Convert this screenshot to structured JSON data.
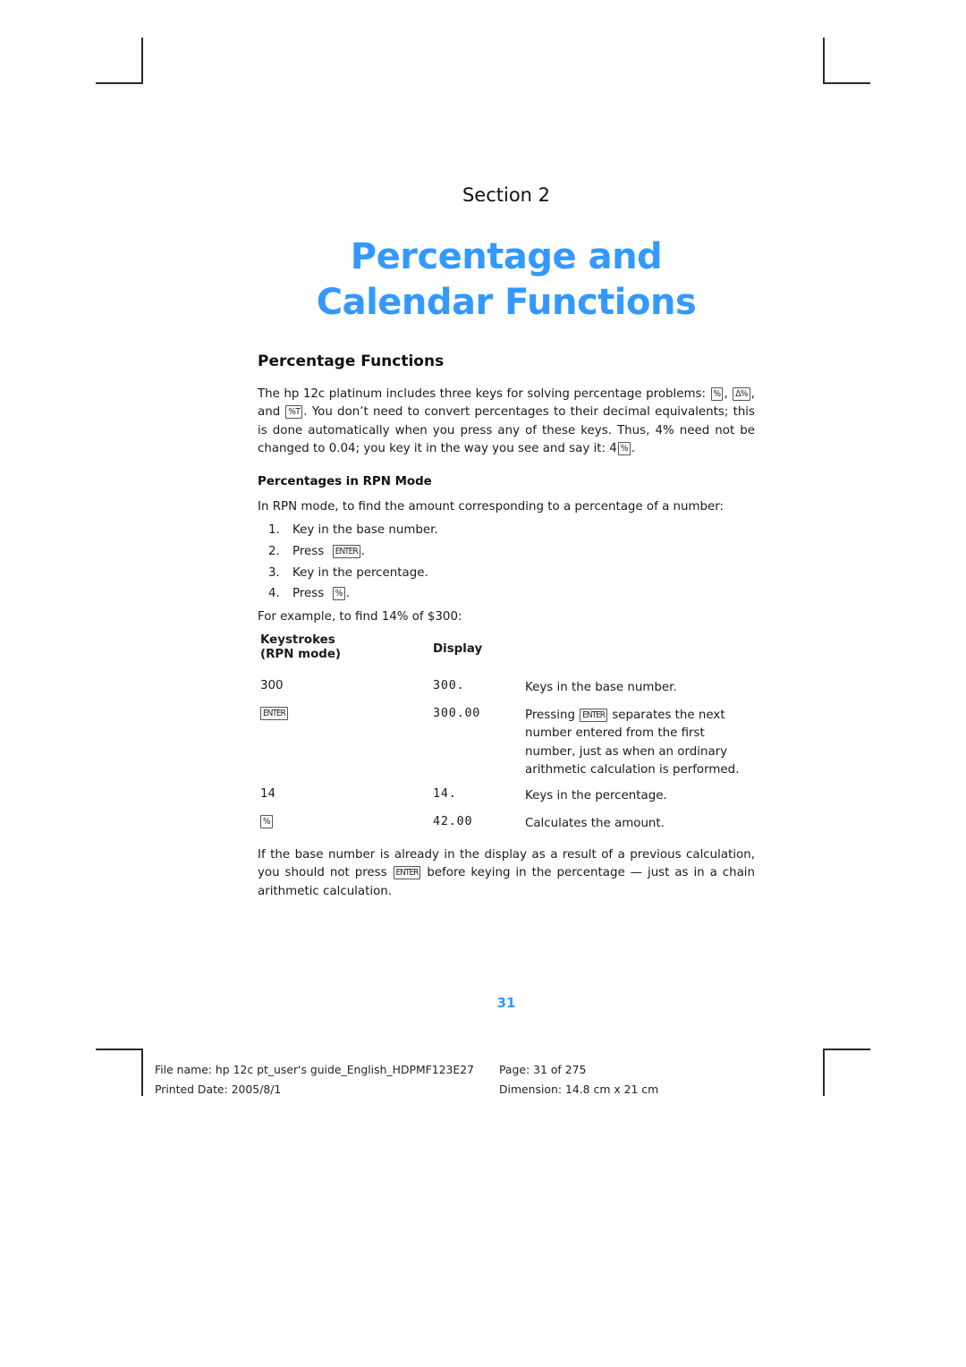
{
  "section_label": "Section 2",
  "chapter_title": "Percentage and Calendar Functions",
  "heading_percentage_functions": "Percentage Functions",
  "intro": {
    "p1": "The hp 12c platinum includes three keys for solving percentage problems: ",
    "key_percent": "%",
    "sep1": ", ",
    "key_delta_percent": "Δ%",
    "sep2": ",",
    "p2": "and ",
    "key_percent_total": "%T",
    "p3": ". You don’t need to convert percentages to their decimal equivalents; this is done automatically when you press any of these keys. Thus, 4% need not be changed to 0.04; you key it in the way you see and say it: 4",
    "key_percent_end": "%",
    "p4": "."
  },
  "heading_rpn_mode": "Percentages in RPN Mode",
  "rpn_intro": "In RPN mode, to find the amount corresponding to a percentage of a number:",
  "steps": [
    {
      "num": "1.",
      "text": "Key in the base number.",
      "key": "",
      "after": ""
    },
    {
      "num": "2.",
      "text": "Press ",
      "key": "ENTER",
      "after": "."
    },
    {
      "num": "3.",
      "text": "Key in the percentage.",
      "key": "",
      "after": ""
    },
    {
      "num": "4.",
      "text": "Press ",
      "key": "%",
      "after": "."
    }
  ],
  "example_intro": "For example, to find 14% of $300:",
  "table": {
    "headers": {
      "keystrokes_line1": "Keystrokes",
      "keystrokes_line2": "(RPN mode)",
      "display": "Display"
    },
    "rows": [
      {
        "keystroke": "300",
        "display": "300.",
        "description": "Keys in the base number."
      },
      {
        "keystroke_key": "ENTER",
        "display": "300.00",
        "description_pre": "Pressing ",
        "description_key": "ENTER",
        "description_post": " separates the next number entered from the first number, just as when an ordinary arithmetic calculation is performed."
      },
      {
        "keystroke": "14",
        "display": "14.",
        "description": "Keys in the percentage."
      },
      {
        "keystroke_key": "%",
        "display": "42.00",
        "description": "Calculates the amount."
      }
    ]
  },
  "closing": {
    "pre": "If the base number is already in the display as a result of a previous calculation, you should not press ",
    "key": "ENTER",
    "post": " before keying in the percentage — just as in a chain arithmetic calculation."
  },
  "page_number": "31",
  "footer": {
    "file_name": "File name: hp 12c pt_user's guide_English_HDPMF123E27",
    "page": "Page: 31 of 275",
    "printed_date": "Printed Date: 2005/8/1",
    "dimension": "Dimension: 14.8 cm x 21 cm"
  },
  "colors": {
    "accent": "#3399ff",
    "text": "#1a1a1a"
  }
}
